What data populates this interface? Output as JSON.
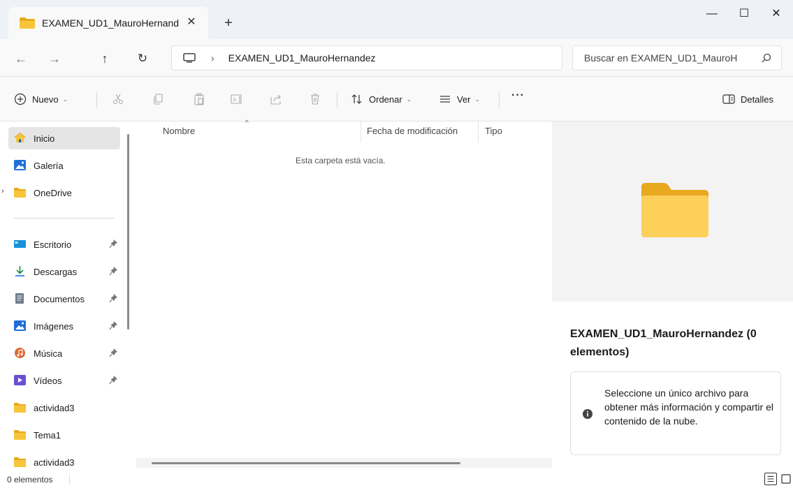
{
  "window": {
    "tab_title": "EXAMEN_UD1_MauroHernand",
    "tab_close": "✕",
    "new_tab": "+",
    "minimize": "—",
    "maximize": "☐",
    "close": "✕"
  },
  "address": {
    "back": "←",
    "forward": "→",
    "up": "↑",
    "refresh": "↻",
    "separator": "›",
    "crumb": "EXAMEN_UD1_MauroHernandez",
    "search_placeholder": "Buscar en EXAMEN_UD1_MauroH"
  },
  "toolbar": {
    "new_label": "Nuevo",
    "sort_label": "Ordenar",
    "view_label": "Ver",
    "more_label": "···",
    "details_label": "Detalles",
    "chevron": "⌄"
  },
  "sidebar": {
    "items": [
      {
        "label": "Inicio",
        "icon": "home-icon"
      },
      {
        "label": "Galería",
        "icon": "gallery-icon"
      },
      {
        "label": "OneDrive",
        "icon": "folder-icon"
      },
      {
        "label": "Escritorio",
        "icon": "desktop-icon"
      },
      {
        "label": "Descargas",
        "icon": "download-icon"
      },
      {
        "label": "Documentos",
        "icon": "documents-icon"
      },
      {
        "label": "Imágenes",
        "icon": "pictures-icon"
      },
      {
        "label": "Música",
        "icon": "music-icon"
      },
      {
        "label": "Vídeos",
        "icon": "videos-icon"
      },
      {
        "label": "actividad3",
        "icon": "folder-icon"
      },
      {
        "label": "Tema1",
        "icon": "folder-icon"
      },
      {
        "label": "actividad3",
        "icon": "folder-icon"
      }
    ],
    "expander": "›"
  },
  "content": {
    "columns": [
      "Nombre",
      "Fecha de modificación",
      "Tipo"
    ],
    "sort_arrow": "^",
    "empty_message": "Esta carpeta está vacía."
  },
  "details_pane": {
    "title": "EXAMEN_UD1_MauroHernandez (0 elementos)",
    "info": "Seleccione un único archivo para obtener más información y compartir el contenido de la nube."
  },
  "status": {
    "count": "0 elementos"
  },
  "colors": {
    "folder": "#f8c53a",
    "folder_dark": "#e8a91f",
    "accent": "#0067c0"
  }
}
